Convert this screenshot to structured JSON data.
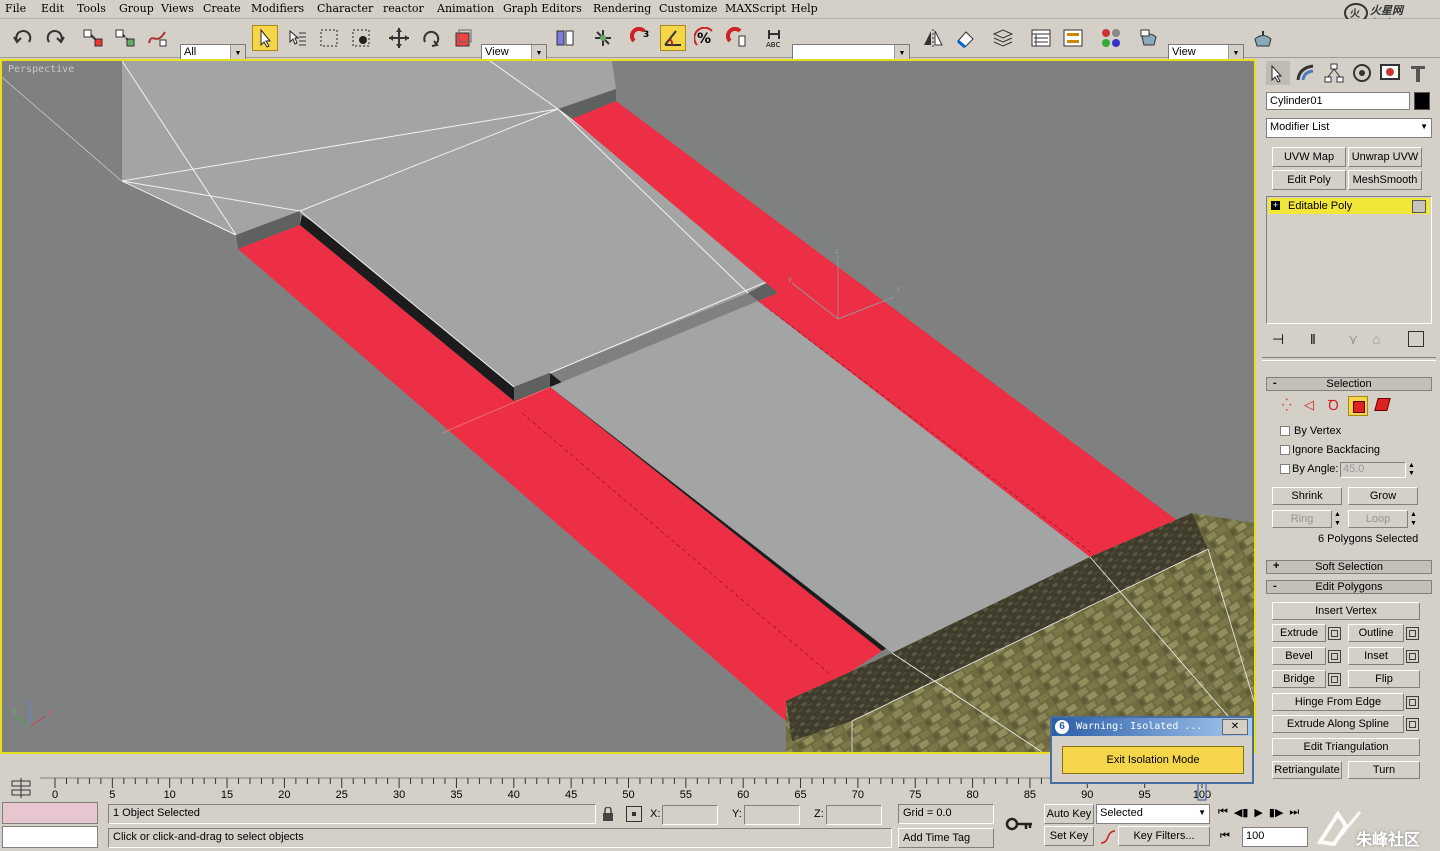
{
  "menu": [
    "File",
    "Edit",
    "Tools",
    "Group",
    "Views",
    "Create",
    "Modifiers",
    "Character",
    "reactor",
    "Animation",
    "Graph Editors",
    "Rendering",
    "Customize",
    "MAXScript",
    "Help"
  ],
  "toolbar": {
    "filter_value": "All",
    "ref_coord_value": "View",
    "named_sel_value": "",
    "render_type_value": "View",
    "icons": [
      "undo-icon",
      "redo-icon",
      "select-link-icon",
      "unlink-icon",
      "bind-spacewarp-icon",
      "select-object-icon",
      "select-by-name-icon",
      "rect-region-icon",
      "window-crossing-icon",
      "move-icon",
      "rotate-icon",
      "scale-icon",
      "pivot-icon",
      "manipulate-icon",
      "snap-icon",
      "angle-snap-icon",
      "percent-snap-icon",
      "spinner-snap-icon",
      "edit-named-sel-icon",
      "mirror-icon",
      "align-icon",
      "layer-manager-icon",
      "curve-editor-icon",
      "schematic-view-icon",
      "material-editor-icon",
      "render-scene-icon",
      "quick-render-icon"
    ]
  },
  "logo_text": "火星网 hxsd.com",
  "viewport": {
    "label": "Perspective",
    "colors": {
      "selected": "#ec2f44",
      "mesh": "#a2a5a4",
      "bg": "#7e8180",
      "border": "#e8df1e"
    }
  },
  "panel": {
    "object_name": "Cylinder01",
    "modifier_list": "Modifier List",
    "quick_buttons": [
      "UVW Map",
      "Unwrap UVW",
      "Edit Poly",
      "MeshSmooth"
    ],
    "stack_item": "Editable Poly",
    "selection": {
      "title": "Selection",
      "by_vertex": "By Vertex",
      "ignore_backfacing": "Ignore Backfacing",
      "by_angle": "By Angle:",
      "angle_value": "45.0",
      "shrink": "Shrink",
      "grow": "Grow",
      "ring": "Ring",
      "loop": "Loop",
      "status": "6 Polygons Selected"
    },
    "soft_selection": "Soft Selection",
    "edit_polygons": {
      "title": "Edit Polygons",
      "insert_vertex": "Insert Vertex",
      "extrude": "Extrude",
      "outline": "Outline",
      "bevel": "Bevel",
      "inset": "Inset",
      "bridge": "Bridge",
      "flip": "Flip",
      "hinge": "Hinge From Edge",
      "extrude_spline": "Extrude Along Spline",
      "edit_tri": "Edit Triangulation",
      "retri": "Retriangulate",
      "turn": "Turn"
    }
  },
  "timeline": {
    "ticks": [
      "0",
      "5",
      "10",
      "15",
      "20",
      "25",
      "30",
      "35",
      "40",
      "45",
      "50",
      "55",
      "60",
      "65",
      "70",
      "75",
      "80",
      "85",
      "90",
      "95",
      "100"
    ]
  },
  "status": {
    "selected_count": "1 Object Selected",
    "prompt": "Click or click-and-drag to select objects",
    "x_label": "X:",
    "y_label": "Y:",
    "z_label": "Z:",
    "grid": "Grid = 0.0",
    "add_time_tag": "Add Time Tag",
    "auto_key": "Auto Key",
    "set_key": "Set Key",
    "selected_combo": "Selected",
    "key_filters": "Key Filters...",
    "frame_value": "100"
  },
  "dialog": {
    "title": "Warning: Isolated ...",
    "button": "Exit Isolation Mode"
  },
  "watermark": "朱峰社区"
}
